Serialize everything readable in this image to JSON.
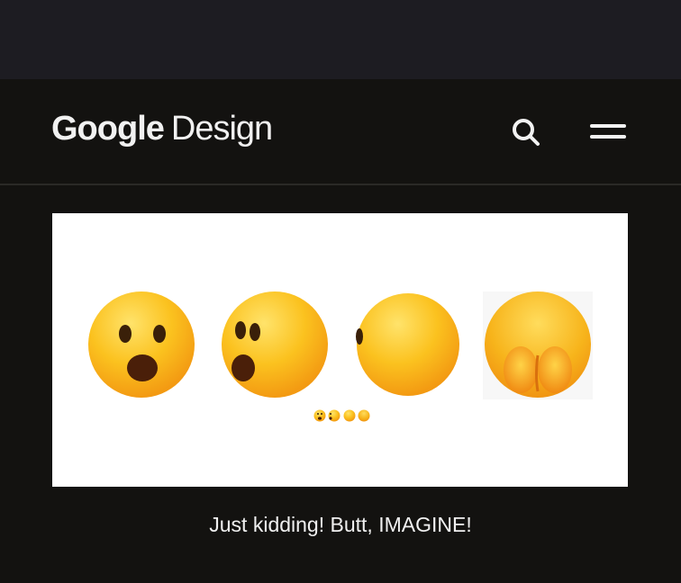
{
  "header": {
    "logo_brand": "Google",
    "logo_product": "Design",
    "search_icon": "search-icon",
    "menu_icon": "menu-icon"
  },
  "hero": {
    "emoji_sequence": [
      "astonished-face-icon",
      "surprised-side-face-icon",
      "back-of-head-icon",
      "butt-face-icon"
    ],
    "accent_color": "#f9b91c"
  },
  "caption": {
    "text": "Just kidding! Butt, IMAGINE!"
  },
  "colors": {
    "background": "#131210",
    "status_bar": "#1d1c22",
    "text": "#f0f0f0"
  }
}
